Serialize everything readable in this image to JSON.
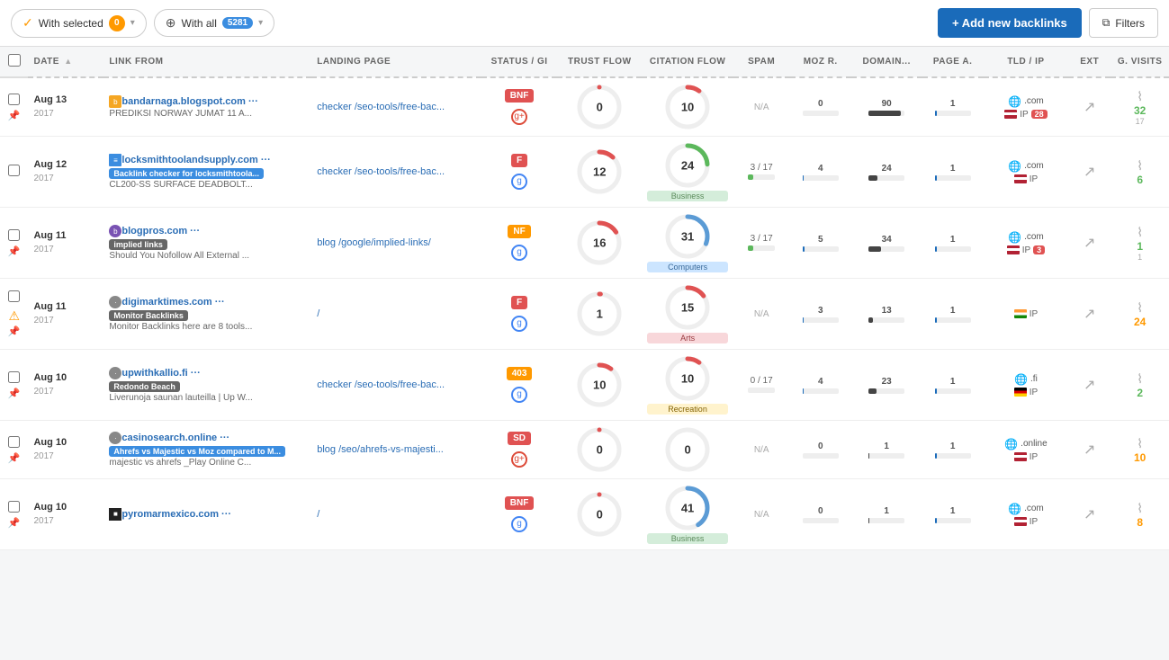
{
  "toolbar": {
    "with_selected_label": "With selected",
    "with_selected_count": "0",
    "with_all_label": "With all",
    "with_all_count": "5281",
    "add_button_label": "+ Add new backlinks",
    "filters_button_label": "Filters"
  },
  "table": {
    "headers": [
      {
        "id": "check",
        "label": ""
      },
      {
        "id": "date",
        "label": "DATE",
        "sort": true
      },
      {
        "id": "link",
        "label": "LINK FROM"
      },
      {
        "id": "landing",
        "label": "LANDING PAGE"
      },
      {
        "id": "status",
        "label": "STATUS / GI"
      },
      {
        "id": "trust",
        "label": "TRUST FLOW"
      },
      {
        "id": "citation",
        "label": "CITATION FLOW"
      },
      {
        "id": "spam",
        "label": "SPAM"
      },
      {
        "id": "moz",
        "label": "MOZ R."
      },
      {
        "id": "domain",
        "label": "DOMAIN..."
      },
      {
        "id": "page",
        "label": "PAGE A."
      },
      {
        "id": "tld",
        "label": "TLD / IP"
      },
      {
        "id": "ext",
        "label": "EXT"
      },
      {
        "id": "visits",
        "label": "G. VISITS"
      }
    ],
    "rows": [
      {
        "date": "Aug 13",
        "year": "2017",
        "domain": "bandarnaga.blogspot.com",
        "domain_suffix": "···",
        "favicon_type": "image",
        "snippet": "PREDIKSI NORWAY JUMAT 11 A...",
        "tag": null,
        "landing": "checker /seo-tools/free-bac...",
        "status_code": "BNF",
        "status_type": "bnf",
        "google_icon": "g+",
        "trust_flow": 0,
        "trust_arc_color": "#e05252",
        "citation_flow": 10,
        "citation_arc_color": "#e05252",
        "spam_val": "N/A",
        "spam_bar_pct": 0,
        "moz_r": 0,
        "moz_bar_pct": 0,
        "domain_val": 90,
        "domain_bar_pct": 90,
        "page_a": 1,
        "page_bar_pct": 5,
        "tld_type": ".com",
        "flag": "us",
        "ip_badge": "28",
        "ext_val": "",
        "gv_val": "32",
        "gv_color": "green",
        "gv_sub": "17",
        "warning": false,
        "pin": true,
        "category": null
      },
      {
        "date": "Aug 12",
        "year": "2017",
        "domain": "locksmithtoolandsupply.com",
        "domain_suffix": "···",
        "favicon_type": "redirect",
        "snippet": "CL200-SS SURFACE DEADBOLT...",
        "tag": "Backlink checker for locksmithtoola...",
        "tag_type": "blue",
        "landing": "checker /seo-tools/free-bac...",
        "status_code": "F",
        "status_type": "f",
        "google_icon": "g",
        "trust_flow": 12,
        "trust_arc_color": "#e05252",
        "citation_flow": 24,
        "citation_arc_color": "#5cb85c",
        "spam_val": "3 / 17",
        "spam_bar_pct": 18,
        "moz_r": 4,
        "moz_bar_pct": 4,
        "domain_val": 24,
        "domain_bar_pct": 24,
        "page_a": 1,
        "page_bar_pct": 5,
        "tld_type": ".com",
        "flag": "us",
        "ip_badge": null,
        "ext_val": "",
        "gv_val": "6",
        "gv_color": "green",
        "gv_sub": "",
        "warning": false,
        "pin": false,
        "category": "Business"
      },
      {
        "date": "Aug 11",
        "year": "2017",
        "domain": "blogpros.com",
        "domain_suffix": "···",
        "favicon_type": "purple",
        "snippet": "Should You Nofollow All External ...",
        "tag": "implied links",
        "tag_type": "gray",
        "landing": "blog /google/implied-links/",
        "status_code": "NF",
        "status_type": "nf",
        "google_icon": "g",
        "trust_flow": 16,
        "trust_arc_color": "#e05252",
        "citation_flow": 31,
        "citation_arc_color": "#5b9bd5",
        "spam_val": "3 / 17",
        "spam_bar_pct": 18,
        "moz_r": 5,
        "moz_bar_pct": 5,
        "domain_val": 34,
        "domain_bar_pct": 34,
        "page_a": 1,
        "page_bar_pct": 5,
        "tld_type": ".com",
        "flag": "us",
        "ip_badge": "3",
        "ext_val": "",
        "gv_val": "1",
        "gv_color": "green",
        "gv_sub": "1",
        "warning": false,
        "pin": true,
        "category": "Computers"
      },
      {
        "date": "Aug 11",
        "year": "2017",
        "domain": "digimarktimes.com",
        "domain_suffix": "···",
        "favicon_type": "round-gray",
        "snippet": "Monitor Backlinks here are 8 tools...",
        "tag": "Monitor Backlinks",
        "tag_type": "gray",
        "landing": "/",
        "status_code": "F",
        "status_type": "f",
        "google_icon": "g",
        "trust_flow": 1,
        "trust_arc_color": "#e05252",
        "citation_flow": 15,
        "citation_arc_color": "#e05252",
        "spam_val": "N/A",
        "spam_bar_pct": 0,
        "moz_r": 3,
        "moz_bar_pct": 3,
        "domain_val": 13,
        "domain_bar_pct": 13,
        "page_a": 1,
        "page_bar_pct": 5,
        "tld_type": null,
        "flag": "in",
        "ip_badge": null,
        "ext_val": "",
        "gv_val": "24",
        "gv_color": "orange",
        "gv_sub": "",
        "warning": true,
        "pin": true,
        "category": "Arts"
      },
      {
        "date": "Aug 10",
        "year": "2017",
        "domain": "upwithkallio.fi",
        "domain_suffix": "···",
        "favicon_type": "round-gray",
        "snippet": "Liverunoja saunan lauteilla | Up W...",
        "tag": "Redondo Beach",
        "tag_type": "gray",
        "landing": "checker /seo-tools/free-bac...",
        "status_code": "403",
        "status_type": "403",
        "google_icon": "g",
        "trust_flow": 10,
        "trust_arc_color": "#e05252",
        "citation_flow": 10,
        "citation_arc_color": "#e05252",
        "spam_val": "0 / 17",
        "spam_bar_pct": 0,
        "moz_r": 4,
        "moz_bar_pct": 4,
        "domain_val": 23,
        "domain_bar_pct": 23,
        "page_a": 1,
        "page_bar_pct": 5,
        "tld_type": ".fi",
        "flag": "de",
        "ip_badge": null,
        "ext_val": "",
        "gv_val": "2",
        "gv_color": "green",
        "gv_sub": "",
        "warning": false,
        "pin": true,
        "category": "Recreation"
      },
      {
        "date": "Aug 10",
        "year": "2017",
        "domain": "casinosearch.online",
        "domain_suffix": "···",
        "favicon_type": "round-gray",
        "snippet": "majestic vs ahrefs _Play Online C...",
        "tag": "Ahrefs vs Majestic vs Moz compared to M...",
        "tag_type": "blue",
        "landing": "blog /seo/ahrefs-vs-majesti...",
        "status_code": "SD",
        "status_type": "sd",
        "google_icon": "g+",
        "trust_flow": 0,
        "trust_arc_color": "#e05252",
        "citation_flow": 0,
        "citation_arc_color": "#eee",
        "spam_val": "N/A",
        "spam_bar_pct": 0,
        "moz_r": 0,
        "moz_bar_pct": 0,
        "domain_val": 1,
        "domain_bar_pct": 1,
        "page_a": 1,
        "page_bar_pct": 5,
        "tld_type": ".online",
        "flag": "us",
        "ip_badge": null,
        "ext_val": "",
        "gv_val": "10",
        "gv_color": "orange",
        "gv_sub": "",
        "warning": false,
        "pin": true,
        "category": null
      },
      {
        "date": "Aug 10",
        "year": "2017",
        "domain": "pyromarmexico.com",
        "domain_suffix": "···",
        "favicon_type": "black-square",
        "snippet": "",
        "tag": null,
        "landing": "/",
        "status_code": "BNF",
        "status_type": "bnf",
        "google_icon": "g",
        "trust_flow": 0,
        "trust_arc_color": "#e05252",
        "citation_flow": 41,
        "citation_arc_color": "#5b9bd5",
        "spam_val": "N/A",
        "spam_bar_pct": 0,
        "moz_r": 0,
        "moz_bar_pct": 0,
        "domain_val": 1,
        "domain_bar_pct": 1,
        "page_a": 1,
        "page_bar_pct": 5,
        "tld_type": ".com",
        "flag": "us",
        "ip_badge": null,
        "ext_val": "",
        "gv_val": "8",
        "gv_color": "orange",
        "gv_sub": "",
        "warning": false,
        "pin": true,
        "category": "Business"
      }
    ]
  }
}
